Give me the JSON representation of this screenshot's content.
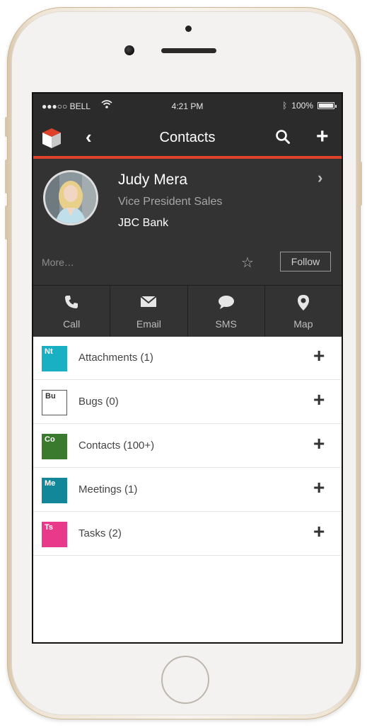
{
  "status_bar": {
    "carrier": "●●●○○ BELL",
    "time": "4:21 PM",
    "battery": "100%"
  },
  "nav": {
    "title": "Contacts",
    "back_icon": "chevron-left-icon",
    "search_icon": "search-icon",
    "add_icon": "plus-icon",
    "back_glyph": "‹",
    "add_glyph": "+"
  },
  "profile": {
    "name": "Judy Mera",
    "role": "Vice President Sales",
    "company": "JBC Bank",
    "chevron_glyph": "›",
    "more_label": "More…",
    "star_glyph": "☆",
    "follow_label": "Follow"
  },
  "actions": [
    {
      "label": "Call",
      "icon": "phone-icon"
    },
    {
      "label": "Email",
      "icon": "envelope-icon"
    },
    {
      "label": "SMS",
      "icon": "chat-bubble-icon"
    },
    {
      "label": "Map",
      "icon": "map-pin-icon"
    }
  ],
  "related_items": [
    {
      "badge": "Nt",
      "label": "Attachments (1)",
      "color": "#1ab0c4"
    },
    {
      "badge": "Bu",
      "label": "Bugs (0)",
      "color": "#ffffff"
    },
    {
      "badge": "Co",
      "label": "Contacts (100+)",
      "color": "#3a7a2f"
    },
    {
      "badge": "Me",
      "label": "Meetings (1)",
      "color": "#13879a"
    },
    {
      "badge": "Ts",
      "label": "Tasks (2)",
      "color": "#e8398a"
    }
  ],
  "add_glyph": "+",
  "colors": {
    "accent": "#e0412b",
    "header_bg": "#2b2b2b",
    "profile_bg": "#333333"
  }
}
